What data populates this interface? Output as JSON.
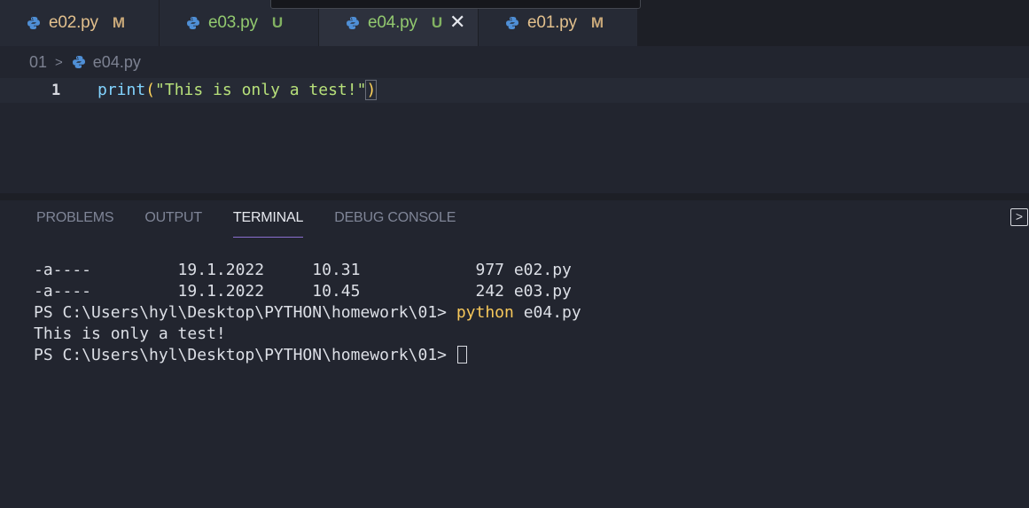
{
  "tabs": [
    {
      "label": "e02.py",
      "badge": "M",
      "label_color": "#e2c08d",
      "badge_color": "#e2c08d"
    },
    {
      "label": "e03.py",
      "badge": "U",
      "label_color": "#92c96f",
      "badge_color": "#92c96f"
    },
    {
      "label": "e04.py",
      "badge": "U",
      "label_color": "#92c96f",
      "badge_color": "#92c96f",
      "close": "✕"
    },
    {
      "label": "e01.py",
      "badge": "M",
      "label_color": "#e2c08d",
      "badge_color": "#e2c08d"
    }
  ],
  "breadcrumb": {
    "folder": "01",
    "separator": ">",
    "file": "e04.py"
  },
  "editor": {
    "line_number": "1",
    "fn": "print",
    "open_paren": "(",
    "string": "\"This is only a test!\"",
    "close_paren": ")"
  },
  "panel": {
    "tabs": [
      "PROBLEMS",
      "OUTPUT",
      "TERMINAL",
      "DEBUG CONSOLE"
    ],
    "expand_icon": ">"
  },
  "terminal": {
    "line1": "-a----         19.1.2022     10.31            977 e02.py",
    "line2": "-a----         19.1.2022     10.45            242 e03.py",
    "line3": "",
    "line4": "",
    "prompt1": "PS C:\\Users\\hyl\\Desktop\\PYTHON\\homework\\01> ",
    "cmd1": "python",
    "arg1": " e04.py",
    "output": "This is only a test!",
    "prompt2": "PS C:\\Users\\hyl\\Desktop\\PYTHON\\homework\\01> "
  },
  "colors": {
    "python_icon_blue": "#4f8fd6",
    "python_icon_yellow": "#4f8fd6"
  }
}
